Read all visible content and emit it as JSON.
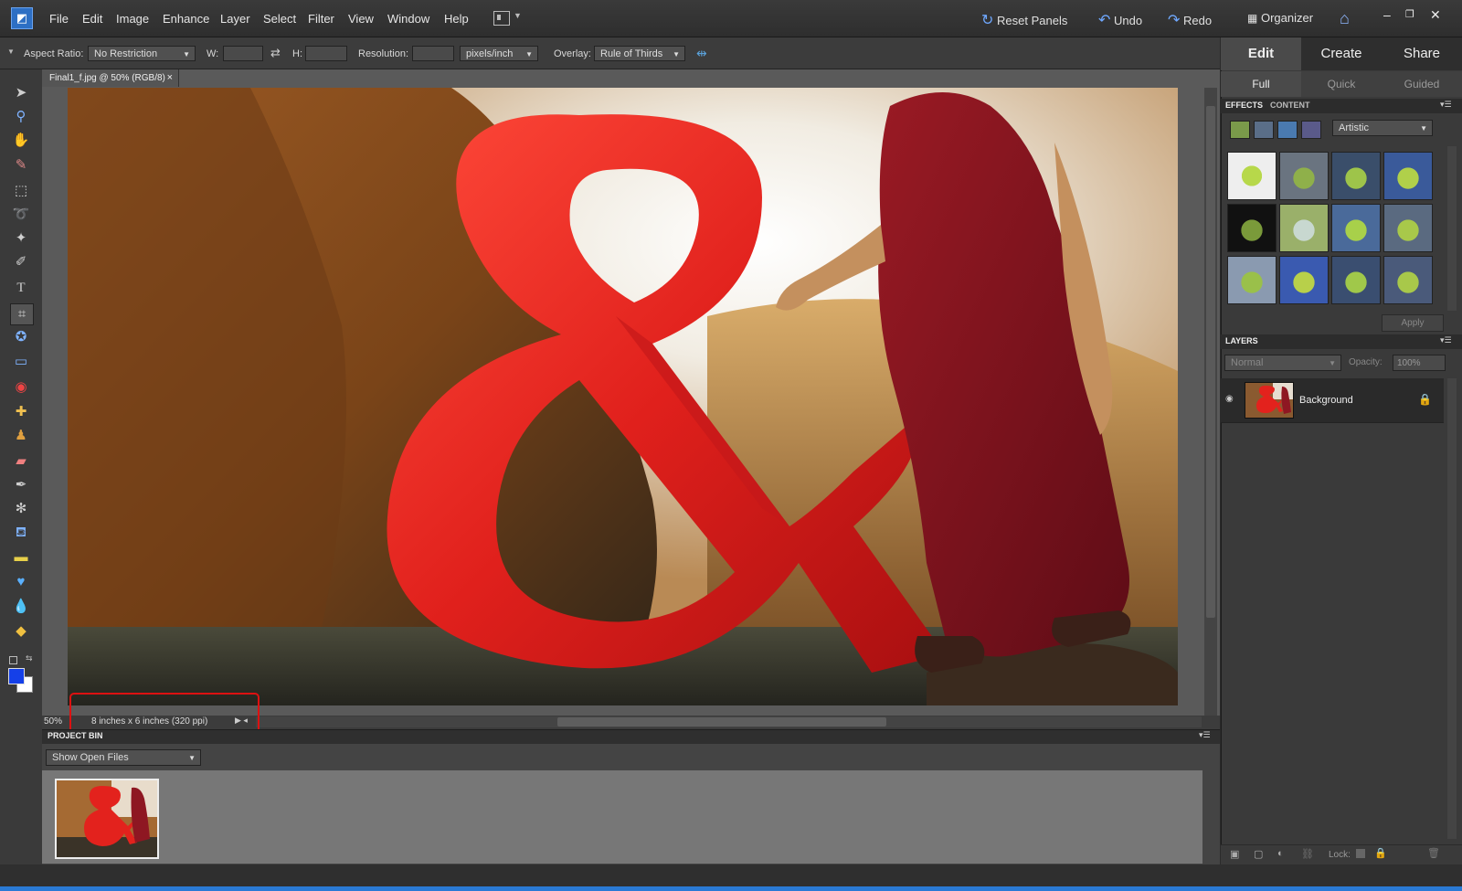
{
  "menu": {
    "items": [
      "File",
      "Edit",
      "Image",
      "Enhance",
      "Layer",
      "Select",
      "Filter",
      "View",
      "Window",
      "Help"
    ],
    "underline": [
      "F",
      "E",
      "I",
      "n",
      "L",
      "S",
      "i",
      "V",
      "W",
      "H"
    ]
  },
  "topright": {
    "reset_panels": "Reset Panels",
    "undo": "Undo",
    "redo": "Redo",
    "organizer": "Organizer"
  },
  "options": {
    "aspect_label": "Aspect Ratio:",
    "aspect_value": "No Restriction",
    "w_label": "W:",
    "h_label": "H:",
    "resolution_label": "Resolution:",
    "resolution_unit": "pixels/inch",
    "overlay_label": "Overlay:",
    "overlay_value": "Rule of Thirds"
  },
  "document": {
    "tab_title": "Final1_f.jpg @ 50% (RGB/8)",
    "zoom": "50%",
    "size_info": "8 inches x 6 inches (320 ppi)"
  },
  "project_bin": {
    "title": "PROJECT BIN",
    "select_value": "Show Open Files"
  },
  "right_panel": {
    "modes": [
      "Edit",
      "Create",
      "Share"
    ],
    "submodes": [
      "Full",
      "Quick",
      "Guided"
    ],
    "effects_tab": "EFFECTS",
    "content_tab": "CONTENT",
    "effects_category": "Artistic",
    "apply": "Apply",
    "layers_title": "LAYERS",
    "blend_mode": "Normal",
    "opacity_label": "Opacity:",
    "opacity_value": "100%",
    "layer_name": "Background",
    "lock_label": "Lock:"
  },
  "colors": {
    "accent_blue": "#2d6fc4",
    "highlight_red": "#d11111",
    "ampersand_red": "#e0201c"
  }
}
